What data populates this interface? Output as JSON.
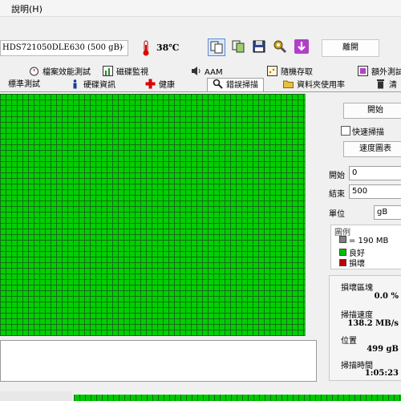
{
  "menu": {
    "help": "說明(H)"
  },
  "toolbar": {
    "drive": "HDS721050DLE630 (500 gB)",
    "temperature": "38℃",
    "exit_label": "離開"
  },
  "tabs_row1": [
    "檔案效能測試",
    "磁碟監視",
    "AAM",
    "隨機存取",
    "額外測試"
  ],
  "tabs_row2": [
    "標準測試",
    "硬碟資訊",
    "健康",
    "錯誤掃描",
    "資料夾使用率",
    "清"
  ],
  "scan": {
    "start_label": "開始",
    "quick_scan_label": "快速掃描",
    "speed_map_label": "速度圖表",
    "start_label_field": "開始",
    "start_value": "0",
    "end_label": "結束",
    "end_value": "500",
    "unit_label": "單位",
    "unit_value": "gB"
  },
  "legend": {
    "title": "圖例",
    "block": "= 190 MB",
    "good": "良好",
    "bad": "損壞",
    "colors": {
      "block": "#808080",
      "good": "#00c000",
      "bad": "#c00000"
    }
  },
  "stats": {
    "damaged_label": "損壞區塊",
    "damaged_value": "0.0 %",
    "speed_label": "掃描速度",
    "speed_value": "138.2 MB/s",
    "position_label": "位置",
    "position_value": "499 gB",
    "time_label": "掃描時間",
    "time_value": "1:05:23"
  },
  "colors": {
    "scan_good": "#00d000",
    "grid_line": "#1a6a1a"
  }
}
